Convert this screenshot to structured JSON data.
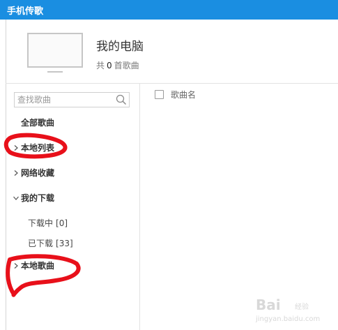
{
  "window": {
    "title": "手机传歌"
  },
  "device": {
    "name": "我的电脑",
    "count_prefix": "共",
    "count": "0",
    "count_suffix": "首歌曲"
  },
  "search": {
    "placeholder": "查找歌曲",
    "value": ""
  },
  "nav": {
    "all_songs": "全部歌曲",
    "local_list": "本地列表",
    "online_favorites": "网络收藏",
    "my_downloads": "我的下载",
    "downloading": {
      "label": "下载中",
      "count": "[0]"
    },
    "downloaded": {
      "label": "已下载",
      "count": "[33]"
    },
    "local_songs": "本地歌曲"
  },
  "song_table": {
    "column_name": "歌曲名"
  },
  "watermark": {
    "brand": "Bai",
    "brand_suffix": "经验",
    "url": "jingyan.baidu.com"
  },
  "colors": {
    "titlebar": "#1a8ee1",
    "annotation": "#e8101a",
    "border": "#e2e2e2"
  },
  "icons": [
    "monitor-icon",
    "search-icon",
    "chevron-right-icon",
    "chevron-down-icon",
    "checkbox-icon"
  ]
}
